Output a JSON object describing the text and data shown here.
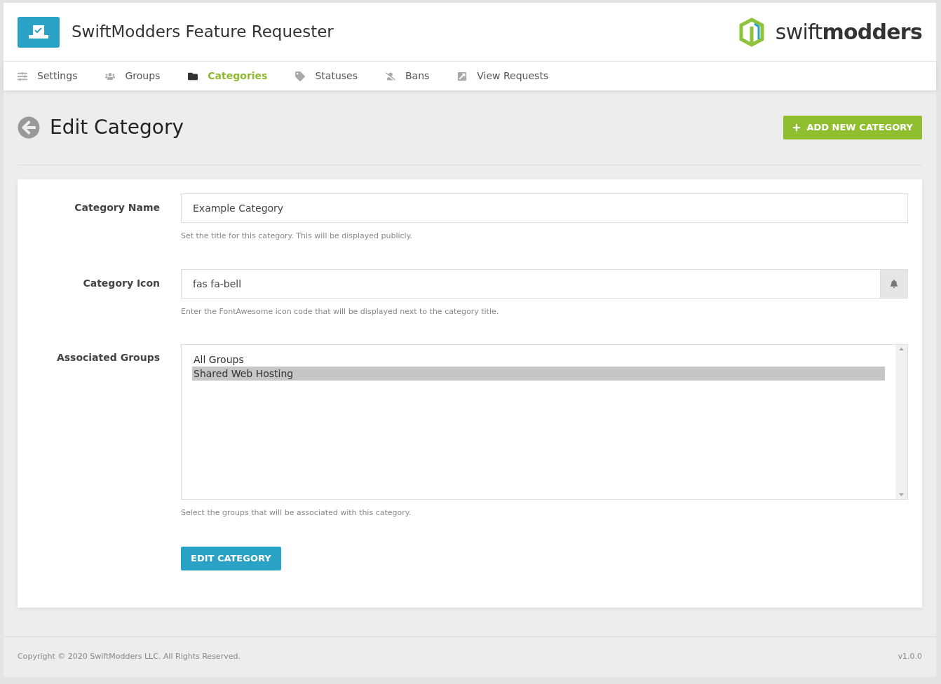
{
  "header": {
    "title": "SwiftModders Feature Requester",
    "brand": "swift**modders**"
  },
  "nav": [
    {
      "label": "Settings",
      "kind": "sliders",
      "selected": false
    },
    {
      "label": "Groups",
      "kind": "users",
      "selected": false
    },
    {
      "label": "Categories",
      "kind": "folder",
      "selected": true
    },
    {
      "label": "Statuses",
      "kind": "tag",
      "selected": false
    },
    {
      "label": "Bans",
      "kind": "ban",
      "selected": false
    },
    {
      "label": "View Requests",
      "kind": "external",
      "selected": false
    }
  ],
  "page": {
    "title": "Edit Category",
    "add_button": "ADD NEW CATEGORY"
  },
  "form": {
    "category_name": {
      "label": "Category Name",
      "value": "Example Category",
      "help": "Set the title for this category. This will be displayed publicly."
    },
    "category_icon": {
      "label": "Category Icon",
      "value": "fas fa-bell",
      "help": "Enter the FontAwesome icon code that will be displayed next to the category title."
    },
    "associated_groups": {
      "label": "Associated Groups",
      "options": [
        {
          "label": "All Groups",
          "selected": false
        },
        {
          "label": "Shared Web Hosting",
          "selected": true
        }
      ],
      "help": "Select the groups that will be associated with this category."
    },
    "submit": "EDIT CATEGORY"
  },
  "footer": {
    "copyright": "Copyright © 2020 SwiftModders LLC. All Rights Reserved.",
    "version": "v1.0.0"
  }
}
